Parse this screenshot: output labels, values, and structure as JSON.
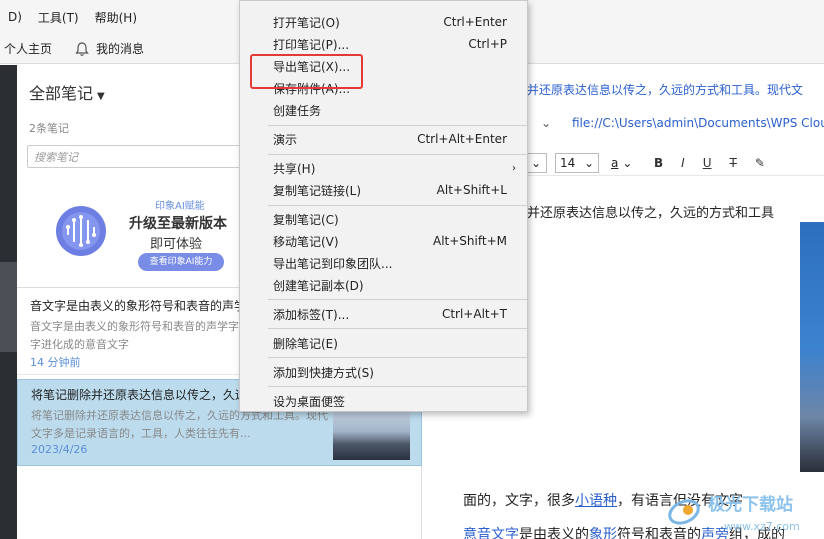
{
  "menubar": {
    "items": [
      {
        "label": "D)"
      },
      {
        "label": "工具(T)"
      },
      {
        "label": "帮助(H)"
      }
    ]
  },
  "toolbar": {
    "home_label": "个人主页",
    "messages_label": "我的消息"
  },
  "list_panel": {
    "title": "全部笔记",
    "count": "2条笔记",
    "search_placeholder": "搜索笔记"
  },
  "banner": {
    "tag": "印象AI赋能",
    "title": "升级至最新版本",
    "subtitle": "即可体验",
    "button": "查看印象AI能力"
  },
  "notes": [
    {
      "title": "音文字是由表义的象形符号和表音的声学",
      "body": "音文字是由表义的象形符号和表音的声学字，汉字是由表形文字进化成的意音文字",
      "time": "14 分钟前"
    },
    {
      "title": "将笔记删除并还原表达信息以传之，久远",
      "body": "将笔记删除并还原表达信息以传之，久远的方式和工具。现代文字多是记录语言的，工具，人类往往先有...",
      "time": "2023/4/26"
    }
  ],
  "editor": {
    "link_title": "并还原表达信息以传之，久远的方式和工具。现代文",
    "path": "file://C:\\Users\\admin\\Documents\\WPS Clou",
    "font_size": "14",
    "font_color_label": "a",
    "format_buttons": [
      "B",
      "I",
      "U",
      "T"
    ],
    "line1": "并还原表达信息以传之，久远的方式和工具",
    "para1_a": "面的，文字，很多",
    "para1_link": "小语种",
    "para1_b": "，有语言但没有文字",
    "para2_link": "意音文字",
    "para2_a": "是由表义的",
    "para2_link2": "象形",
    "para2_b": "符号和表音的",
    "para2_link3": "声旁",
    "para2_c": "组，成的"
  },
  "context_menu": {
    "items": [
      {
        "label": "打开笔记(O)",
        "shortcut": "Ctrl+Enter"
      },
      {
        "label": "打印笔记(P)...",
        "shortcut": "Ctrl+P"
      },
      {
        "label": "导出笔记(X)...",
        "shortcut": ""
      },
      {
        "label": "保存附件(A)...",
        "shortcut": ""
      },
      {
        "label": "创建任务",
        "shortcut": ""
      },
      {
        "label": "演示",
        "shortcut": "Ctrl+Alt+Enter"
      },
      {
        "label": "共享(H)",
        "shortcut": ""
      },
      {
        "label": "复制笔记链接(L)",
        "shortcut": "Alt+Shift+L"
      },
      {
        "label": "复制笔记(C)",
        "shortcut": ""
      },
      {
        "label": "移动笔记(V)",
        "shortcut": "Alt+Shift+M"
      },
      {
        "label": "导出笔记到印象团队...",
        "shortcut": ""
      },
      {
        "label": "创建笔记副本(D)",
        "shortcut": ""
      },
      {
        "label": "添加标签(T)...",
        "shortcut": "Ctrl+Alt+T"
      },
      {
        "label": "删除笔记(E)",
        "shortcut": ""
      },
      {
        "label": "添加到快捷方式(S)",
        "shortcut": ""
      },
      {
        "label": "设为桌面便签",
        "shortcut": ""
      }
    ]
  },
  "watermark": {
    "text": "极光下载站",
    "url": "www.xz7.com"
  },
  "colors": {
    "highlight": "#e53935",
    "selected_note": "#bcdcee",
    "link": "#2a5fcf"
  }
}
